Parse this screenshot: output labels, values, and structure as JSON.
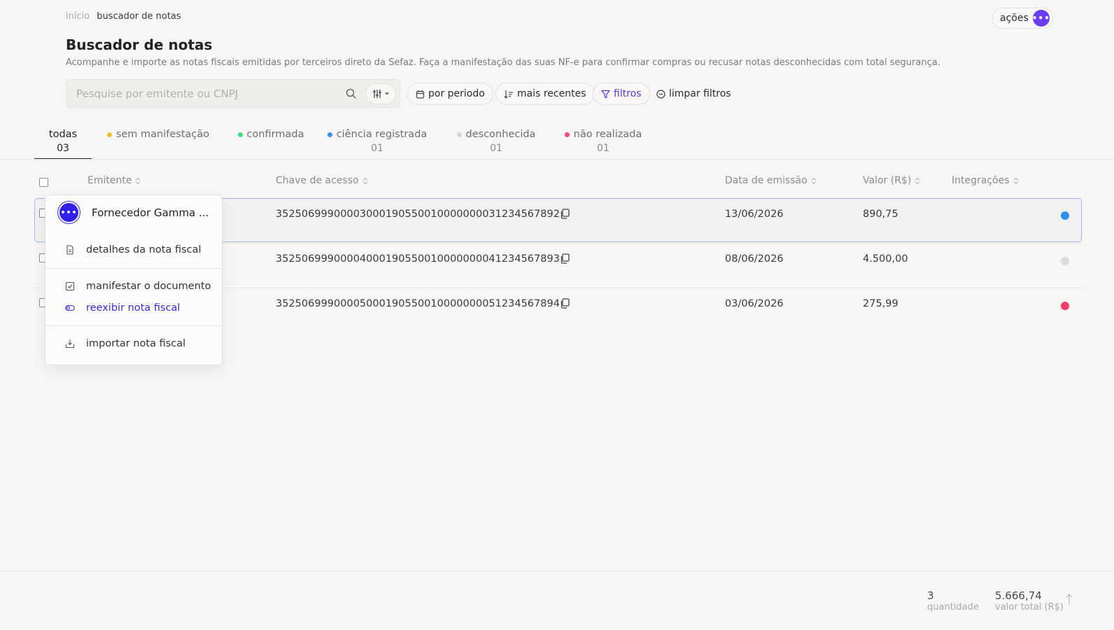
{
  "breadcrumb": {
    "home": "início",
    "current": "buscador de notas"
  },
  "header": {
    "actions_label": "ações",
    "title": "Buscador de notas",
    "description": "Acompanhe e importe as notas fiscais emitidas por terceiros direto da Sefaz. Faça a manifestação das suas NF-e para confirmar compras ou recusar notas desconhecidas com total segurança."
  },
  "search": {
    "placeholder": "Pesquise por emitente ou CNPJ",
    "value": ""
  },
  "toolbar": {
    "period_label": "por periodo",
    "sort_label": "mais recentes",
    "filters_label": "filtros",
    "clear_label": "limpar filtros"
  },
  "tabs": [
    {
      "label": "todas",
      "count": "03",
      "dot_color": ""
    },
    {
      "label": "sem manifestação",
      "count": "",
      "dot_color": "#e6c234"
    },
    {
      "label": "confirmada",
      "count": "",
      "dot_color": "#3ddc8a"
    },
    {
      "label": "ciência registrada",
      "count": "01",
      "dot_color": "#3b8ef0"
    },
    {
      "label": "desconhecida",
      "count": "01",
      "dot_color": "#d6d6d6"
    },
    {
      "label": "não realizada",
      "count": "01",
      "dot_color": "#f04c7a"
    }
  ],
  "table": {
    "columns": [
      "Emitente",
      "Chave de acesso",
      "Data de emissão",
      "Valor (R$)",
      "Integrações"
    ],
    "rows": [
      {
        "key": "35250699900003000190550010000000031234567892",
        "date": "13/06/2026",
        "value": "890,75",
        "status_color": "#2f8fec"
      },
      {
        "key": "35250699900004000190550010000000041234567893",
        "date": "08/06/2026",
        "value": "4.500,00",
        "status_color": "#dcdcdc"
      },
      {
        "key": "35250699900005000190550010000000051234567894",
        "date": "03/06/2026",
        "value": "275,99",
        "status_color": "#ec3f6a"
      }
    ]
  },
  "menu": {
    "title": "Fornecedor Gamma ...",
    "items": [
      {
        "label": "detalhes da nota fiscal",
        "icon": "document-icon"
      },
      {
        "label": "manifestar o documento",
        "icon": "checkbox-icon"
      },
      {
        "label": "reexibir nota fiscal",
        "icon": "toggle-icon"
      },
      {
        "label": "importar nota fiscal",
        "icon": "import-icon"
      }
    ]
  },
  "footer": {
    "quantity": "3",
    "quantity_label": "quantidade",
    "total": "5.666,74",
    "total_label": "valor total (R$)"
  },
  "colors": {
    "accent": "#6b3df5",
    "menu_accent": "#3320e8",
    "selected_border": "#a9b5f0"
  }
}
